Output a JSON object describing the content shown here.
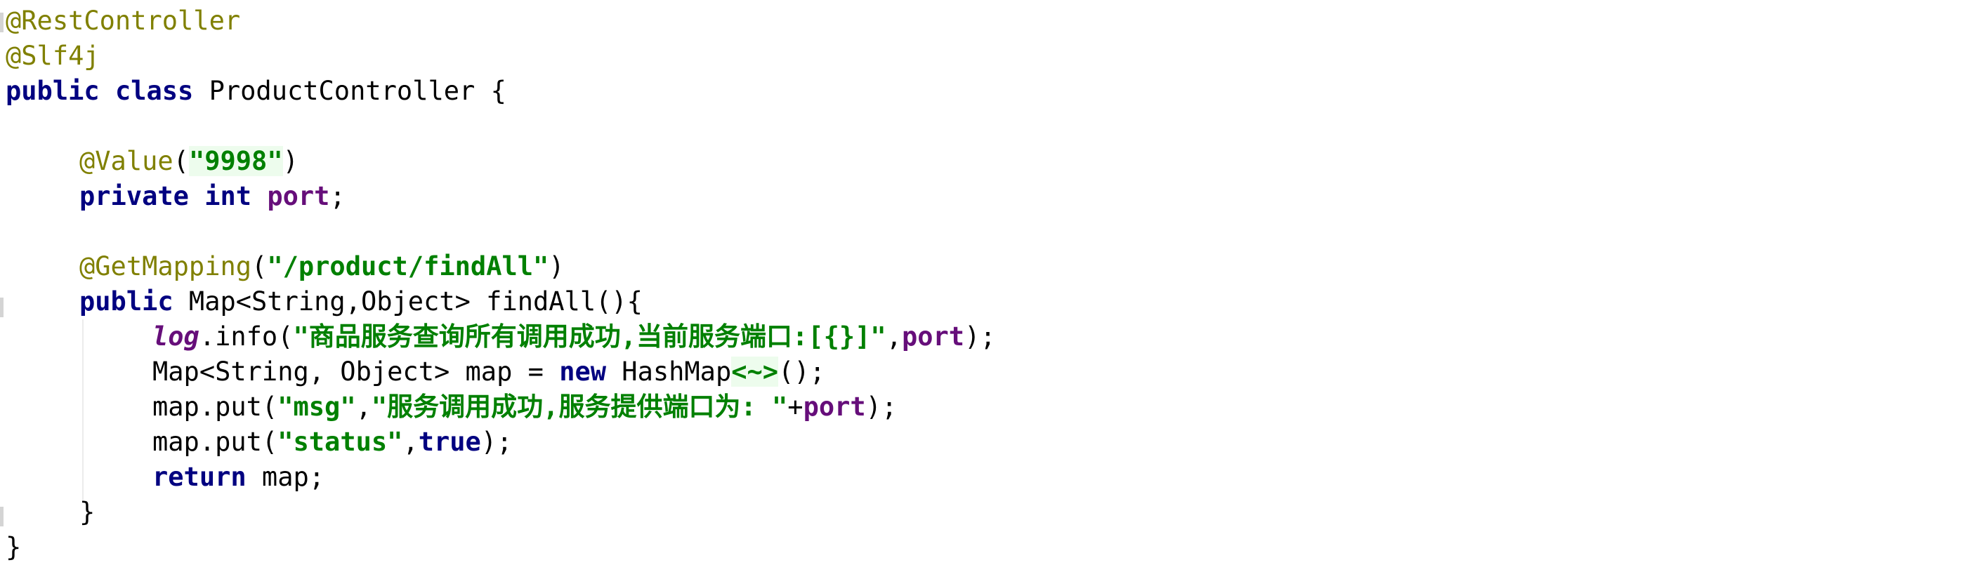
{
  "code": {
    "l1": {
      "annotation": "@RestController"
    },
    "l2": {
      "annotation": "@Slf4j"
    },
    "l3": {
      "kw_public": "public",
      "kw_class": "class",
      "rest": " ProductController {"
    },
    "l4": {
      "annotation": "@Value",
      "open": "(",
      "value": "\"9998\"",
      "close": ")"
    },
    "l5": {
      "kw_private": "private",
      "kw_int": "int",
      "field": "port",
      "end": ";"
    },
    "l6": {
      "annotation": "@GetMapping",
      "open": "(",
      "value": "\"/product/findAll\"",
      "close": ")"
    },
    "l7": {
      "kw_public": "public",
      "rest": " Map<String,Object> findAll(){"
    },
    "l8": {
      "log": "log",
      "call": ".info(",
      "message": "\"商品服务查询所有调用成功,当前服务端口:[{}]\"",
      "comma": ",",
      "field": "port",
      "end": ");"
    },
    "l9": {
      "decl": "Map<String, Object> map = ",
      "kw_new": "new",
      "type": " HashMap",
      "diamond": "<~>",
      "end": "();"
    },
    "l10": {
      "call": "map.put(",
      "key": "\"msg\"",
      "comma": ",",
      "value": "\"服务调用成功,服务提供端口为: \"",
      "plus": "+",
      "field": "port",
      "end": ");"
    },
    "l11": {
      "call": "map.put(",
      "key": "\"status\"",
      "comma": ",",
      "kw_true": "true",
      "end": ");"
    },
    "l12": {
      "kw_return": "return",
      "rest": " map;"
    },
    "l13": {
      "brace": "}"
    },
    "l14": {
      "brace": "}"
    }
  },
  "colors": {
    "background": "#ffffff",
    "keyword": "#000080",
    "annotation": "#808000",
    "string": "#008000",
    "field": "#660e7a",
    "default": "#000000"
  }
}
